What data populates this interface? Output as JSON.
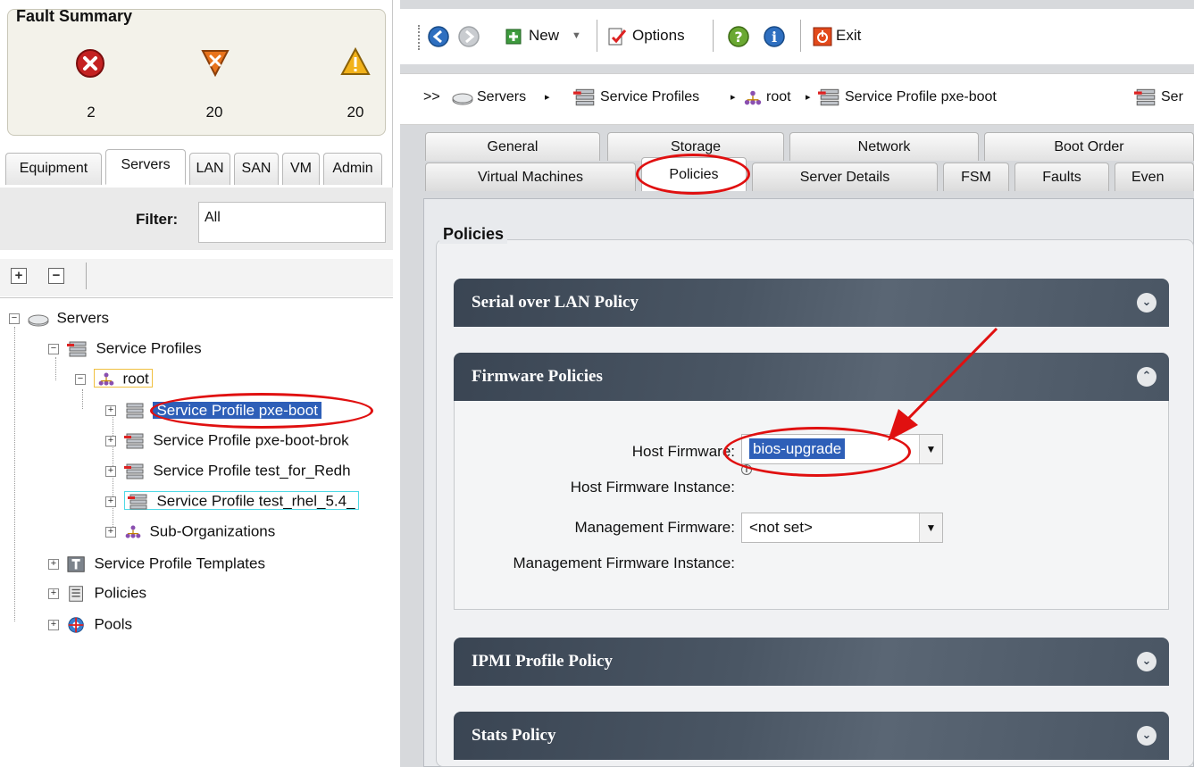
{
  "fault_summary": {
    "title": "Fault Summary",
    "critical_count": "2",
    "major_count": "20",
    "minor_count": "20"
  },
  "left_tabs": [
    "Equipment",
    "Servers",
    "LAN",
    "SAN",
    "VM",
    "Admin"
  ],
  "filter": {
    "label": "Filter:",
    "value": "All"
  },
  "tree": {
    "servers": "Servers",
    "service_profiles": "Service Profiles",
    "root": "root",
    "sp_pxe_boot": "Service Profile pxe-boot",
    "sp_pxe_boot_brok": "Service Profile pxe-boot-brok",
    "sp_test_for_redh": "Service Profile test_for_Redh",
    "sp_test_rhel": "Service Profile test_rhel_5.4_",
    "sub_orgs": "Sub-Organizations",
    "sp_templates": "Service Profile Templates",
    "policies": "Policies",
    "pools": "Pools"
  },
  "toolbar": {
    "new_label": "New",
    "options_label": "Options",
    "exit_label": "Exit"
  },
  "breadcrumb": {
    "prefix": ">>",
    "servers": "Servers",
    "service_profiles": "Service Profiles",
    "root": "root",
    "current": "Service Profile pxe-boot",
    "overflow": "Ser"
  },
  "right_tabs_top": [
    "General",
    "Storage",
    "Network",
    "Boot Order"
  ],
  "right_tabs_bottom": [
    "Virtual Machines",
    "Policies",
    "Server Details",
    "FSM",
    "Faults",
    "Even"
  ],
  "main": {
    "title": "Policies",
    "sections": {
      "sol": "Serial over LAN Policy",
      "firmware": "Firmware Policies",
      "ipmi": "IPMI Profile Policy",
      "stats": "Stats Policy"
    },
    "firmware": {
      "host_fw_label": "Host Firmware:",
      "host_fw_value": "bios-upgrade",
      "host_fw_instance_label": "Host Firmware Instance:",
      "mgmt_fw_label": "Management Firmware:",
      "mgmt_fw_value": "<not set>",
      "mgmt_fw_instance_label": "Management Firmware Instance:"
    }
  },
  "colors": {
    "accent_red": "#e01010",
    "selection_blue": "#2e5fb8",
    "section_header": "#3a4553"
  }
}
